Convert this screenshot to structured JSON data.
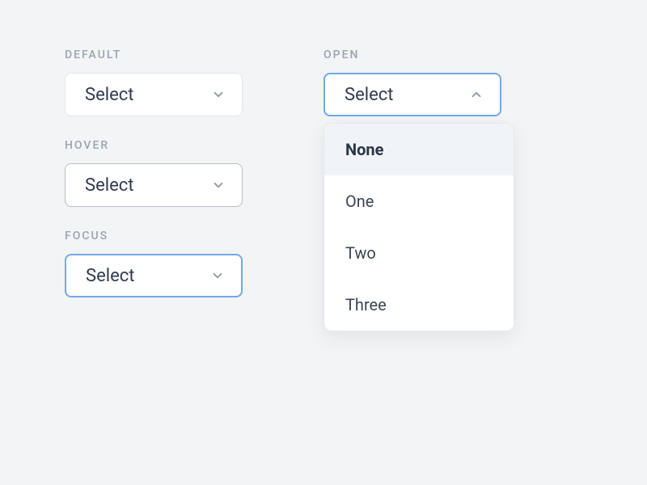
{
  "left": {
    "states": [
      {
        "label": "DEFAULT",
        "value": "Select"
      },
      {
        "label": "HOVER",
        "value": "Select"
      },
      {
        "label": "FOCUS",
        "value": "Select"
      }
    ]
  },
  "right": {
    "label": "OPEN",
    "value": "Select",
    "options": [
      "None",
      "One",
      "Two",
      "Three"
    ],
    "highlighted": "None"
  }
}
